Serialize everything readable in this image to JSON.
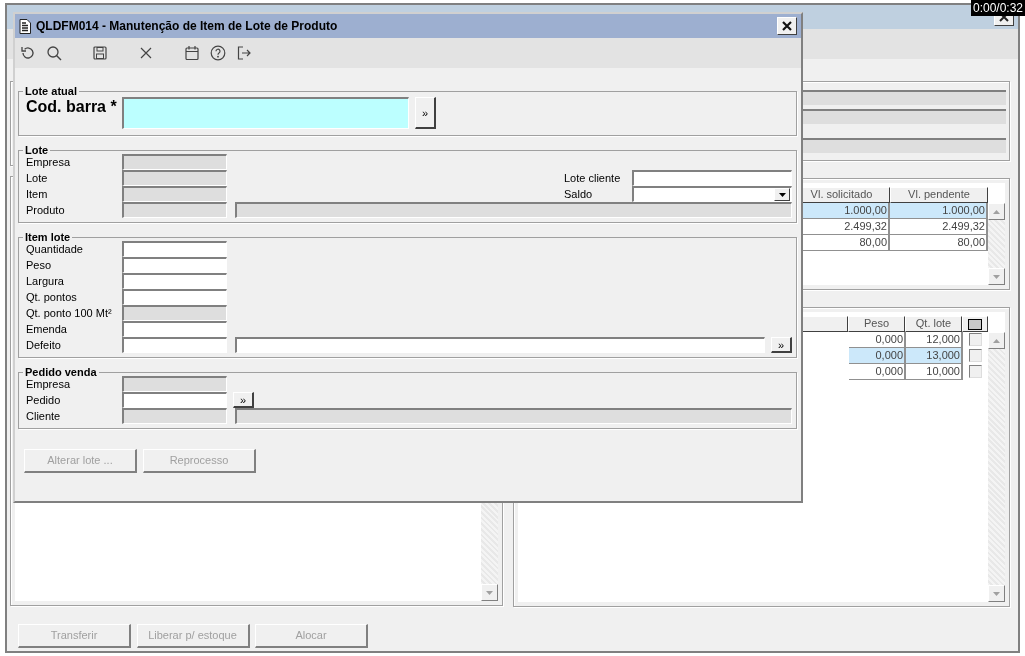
{
  "media_time": "0:00/0:32",
  "background_window": {
    "info_fields": [
      {
        "disabled": true
      },
      {
        "disabled": true
      },
      {
        "disabled": true
      }
    ],
    "grid_1": {
      "columns": [
        "Vl. solicitado",
        "Vl. pendente"
      ],
      "rows": [
        {
          "cells": [
            "1.000,00",
            "1.000,00"
          ],
          "selected": true
        },
        {
          "cells": [
            "2.499,32",
            "2.499,32"
          ],
          "selected": false
        },
        {
          "cells": [
            "80,00",
            "80,00"
          ],
          "selected": false
        }
      ]
    },
    "grid_2": {
      "columns": [
        "Peso",
        "Qt. lote"
      ],
      "rows": [
        {
          "cells": [
            "0,000",
            "12,000"
          ],
          "checked": false,
          "selected": false
        },
        {
          "cells": [
            "0,000",
            "13,000"
          ],
          "checked": false,
          "selected": true
        },
        {
          "cells": [
            "0,000",
            "10,000"
          ],
          "checked": false,
          "selected": false
        }
      ]
    },
    "buttons": [
      {
        "label": "Transferir",
        "disabled": true
      },
      {
        "label": "Liberar p/ estoque",
        "disabled": true
      },
      {
        "label": "Alocar",
        "disabled": true
      }
    ]
  },
  "dialog": {
    "title": "QLDFM014 - Manutenção de Item de Lote de Produto",
    "toolbar": [
      {
        "icons": [
          {
            "kind": "undo"
          },
          {
            "kind": "search"
          }
        ]
      },
      {
        "icons": [
          {
            "kind": "save"
          }
        ]
      },
      {
        "icons": [
          {
            "kind": "close"
          }
        ]
      },
      {
        "icons": [
          {
            "kind": "calendar"
          },
          {
            "kind": "help"
          },
          {
            "kind": "exit"
          }
        ]
      }
    ],
    "groups": [
      {
        "title": "Lote atual",
        "rows": [
          {
            "label": "Cod. barra *",
            "kind": "barcode",
            "fields": [
              {
                "kind": "barcode",
                "disabled": false
              },
              {
                "kind": "lookup",
                "label": "»",
                "disabled": false
              }
            ]
          }
        ]
      },
      {
        "title": "Lote",
        "rows": [
          {
            "label": "Empresa",
            "fields": [
              {
                "kind": "short",
                "disabled": true
              }
            ]
          },
          {
            "label": "Lote",
            "fields": [
              {
                "kind": "short",
                "disabled": true
              }
            ],
            "side": {
              "label": "Lote cliente",
              "field": {
                "kind": "short",
                "disabled": false
              }
            }
          },
          {
            "label": "Item",
            "fields": [
              {
                "kind": "short",
                "disabled": true
              }
            ],
            "side": {
              "label": "Saldo",
              "field": {
                "kind": "select",
                "disabled": false
              }
            }
          },
          {
            "label": "Produto",
            "fields": [
              {
                "kind": "short",
                "disabled": true
              },
              {
                "kind": "wide",
                "disabled": true
              }
            ]
          }
        ]
      },
      {
        "title": "Item lote",
        "rows": [
          {
            "label": "Quantidade",
            "fields": [
              {
                "kind": "short",
                "disabled": false
              }
            ]
          },
          {
            "label": "Peso",
            "fields": [
              {
                "kind": "short",
                "disabled": false
              }
            ]
          },
          {
            "label": "Largura",
            "fields": [
              {
                "kind": "short",
                "disabled": false
              }
            ]
          },
          {
            "label": "Qt. pontos",
            "fields": [
              {
                "kind": "short",
                "disabled": false
              }
            ]
          },
          {
            "label": "Qt. ponto 100 Mt²",
            "fields": [
              {
                "kind": "short",
                "disabled": true
              }
            ]
          },
          {
            "label": "Emenda",
            "fields": [
              {
                "kind": "short",
                "disabled": false
              }
            ]
          },
          {
            "label": "Defeito",
            "fields": [
              {
                "kind": "short",
                "disabled": false
              },
              {
                "kind": "wide",
                "disabled": false
              },
              {
                "kind": "lookup",
                "label": "»",
                "disabled": false
              }
            ]
          }
        ]
      },
      {
        "title": "Pedido venda",
        "rows": [
          {
            "label": "Empresa",
            "fields": [
              {
                "kind": "short",
                "disabled": true
              }
            ]
          },
          {
            "label": "Pedido",
            "fields": [
              {
                "kind": "short",
                "disabled": false
              },
              {
                "kind": "lookup",
                "label": "»",
                "disabled": false
              }
            ]
          },
          {
            "label": "Cliente",
            "fields": [
              {
                "kind": "short",
                "disabled": true
              },
              {
                "kind": "wide",
                "disabled": true
              }
            ]
          }
        ]
      }
    ],
    "buttons": [
      {
        "label": "Alterar lote ...",
        "disabled": true
      },
      {
        "label": "Reprocesso",
        "disabled": true
      }
    ]
  }
}
